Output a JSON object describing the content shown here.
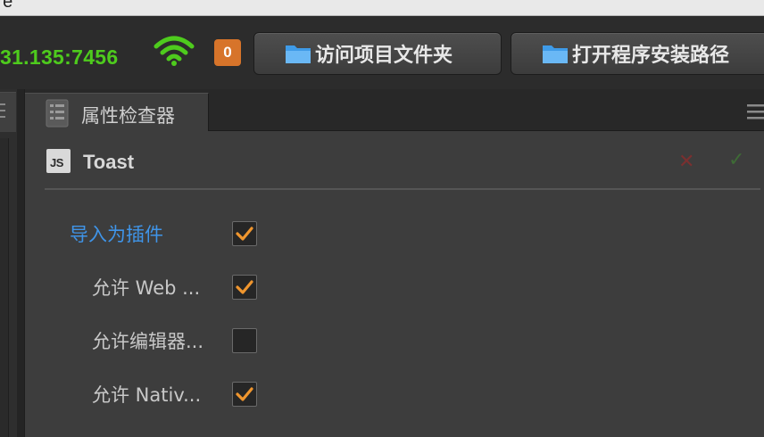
{
  "window": {
    "title_fragment": "ire"
  },
  "toolbar": {
    "address": "31.135:7456",
    "badge_count": "0",
    "buttons": [
      {
        "label": "访问项目文件夹",
        "icon": "folder-icon"
      },
      {
        "label": "打开程序安装路径",
        "icon": "folder-icon"
      }
    ],
    "accent_green": "#4ecb1d",
    "badge_color": "#d7742a"
  },
  "inspector": {
    "tab_label": "属性检查器",
    "component": {
      "name": "Toast",
      "icon_text": "JS"
    },
    "properties": [
      {
        "label": "导入为插件",
        "checked": true,
        "highlight": true
      },
      {
        "label": "允许 Web ...",
        "checked": true,
        "highlight": false
      },
      {
        "label": "允许编辑器...",
        "checked": false,
        "highlight": false
      },
      {
        "label": "允许 Nativ...",
        "checked": true,
        "highlight": false
      }
    ],
    "checkmark_color": "#f0962e",
    "label_highlight_color": "#3f94e8"
  }
}
